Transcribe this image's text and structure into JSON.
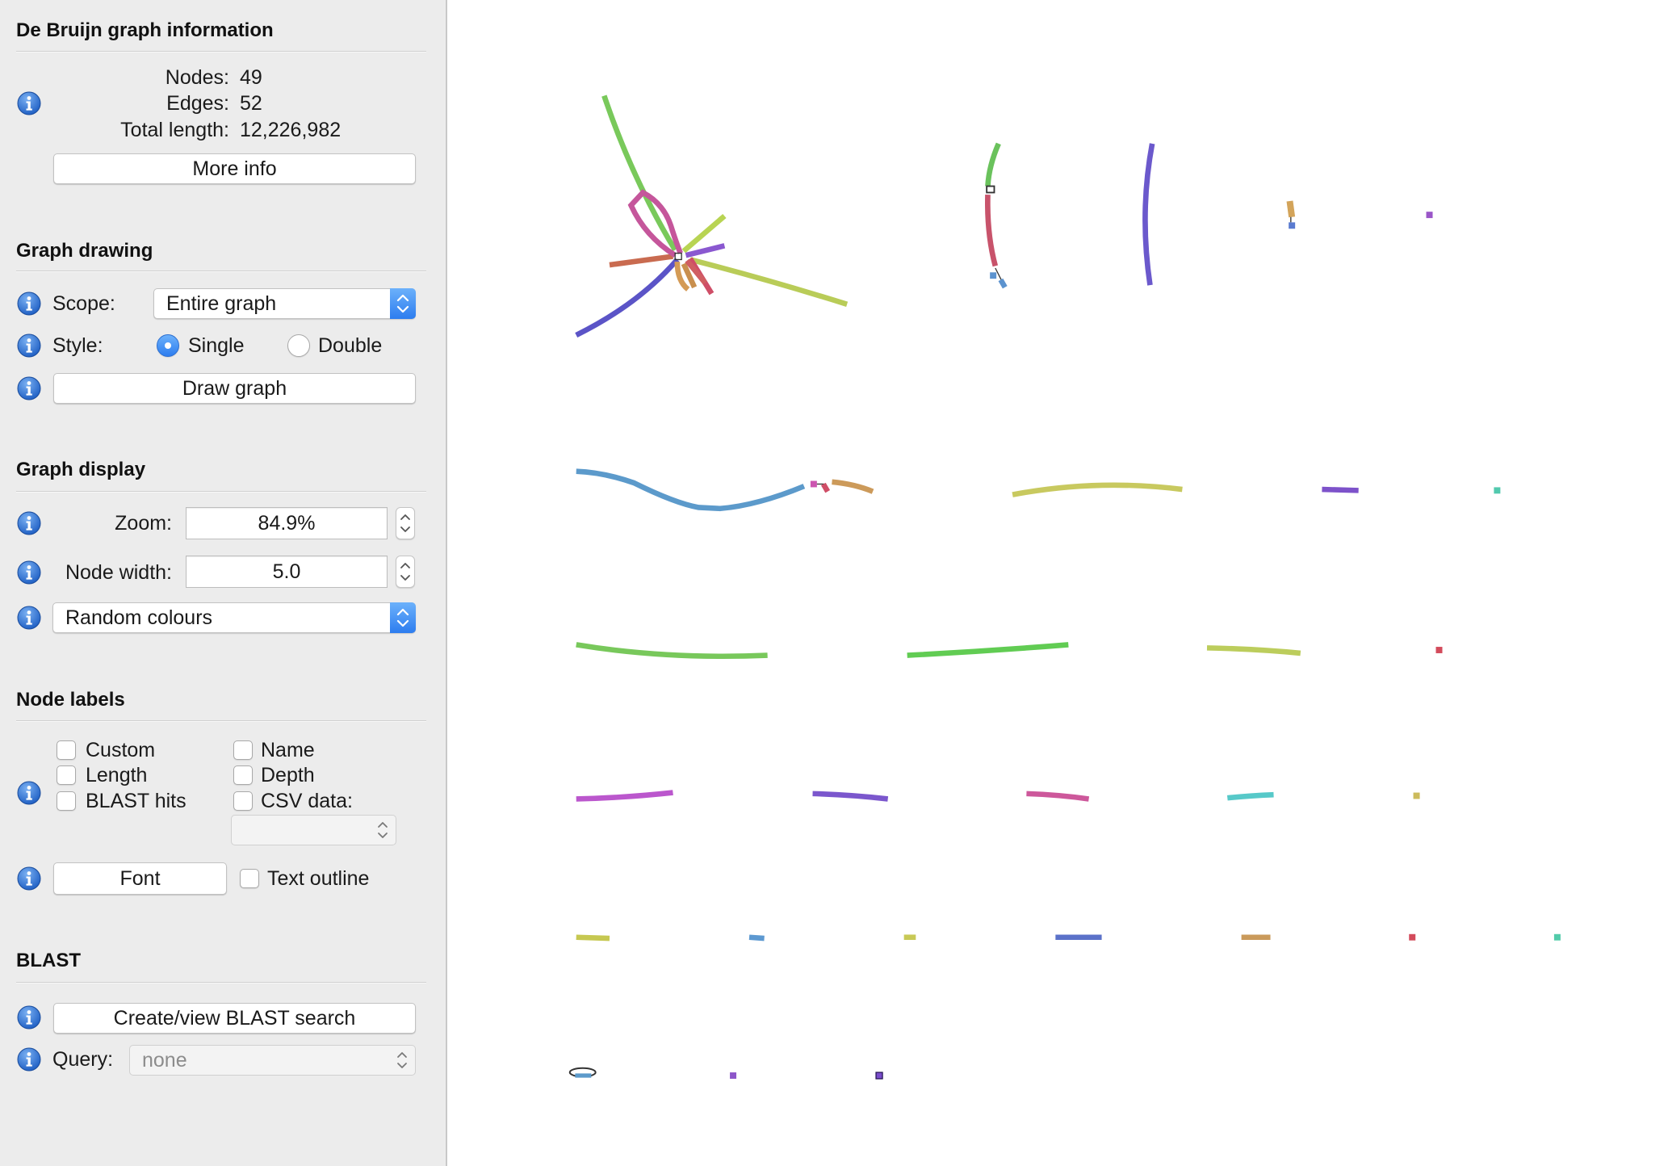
{
  "theme": {
    "accent": "#2d7def",
    "panel_bg": "#ececec",
    "canvas_bg": "#ffffff"
  },
  "icons": {
    "info": "info-icon",
    "select_arrows": "chevron-up-down-icon"
  },
  "info": {
    "title": "De Bruijn graph information",
    "nodes_label": "Nodes:",
    "nodes_value": "49",
    "edges_label": "Edges:",
    "edges_value": "52",
    "length_label": "Total length:",
    "length_value": "12,226,982",
    "more_info": "More info"
  },
  "drawing": {
    "title": "Graph drawing",
    "scope_label": "Scope:",
    "scope_value": "Entire graph",
    "style_label": "Style:",
    "style_options": [
      {
        "label": "Single",
        "selected": true
      },
      {
        "label": "Double",
        "selected": false
      }
    ],
    "draw_button": "Draw graph"
  },
  "display": {
    "title": "Graph display",
    "zoom_label": "Zoom:",
    "zoom_value": "84.9%",
    "node_width_label": "Node width:",
    "node_width_value": "5.0",
    "colour_scheme": "Random colours"
  },
  "labels": {
    "title": "Node labels",
    "options": [
      {
        "label": "Custom",
        "checked": false
      },
      {
        "label": "Length",
        "checked": false
      },
      {
        "label": "BLAST hits",
        "checked": false
      },
      {
        "label": "Name",
        "checked": false
      },
      {
        "label": "Depth",
        "checked": false
      },
      {
        "label": "CSV data:",
        "checked": false
      }
    ],
    "font_button": "Font",
    "text_outline": {
      "label": "Text outline",
      "checked": false
    }
  },
  "blast": {
    "title": "BLAST",
    "create_button": "Create/view BLAST search",
    "query_label": "Query:",
    "query_value": "none"
  }
}
